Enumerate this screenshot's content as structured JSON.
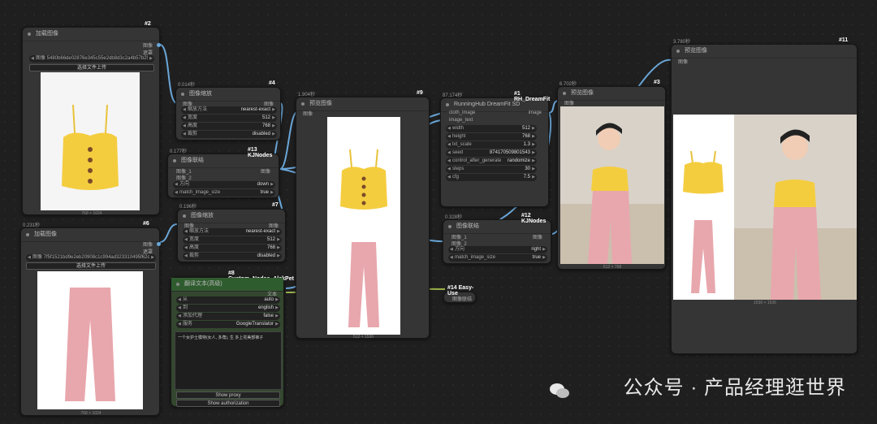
{
  "colors": {
    "wire": "#6aa7d9",
    "node": "#353535",
    "green": "#2f5c2f"
  },
  "load1": {
    "badge": "#2",
    "title": "加载图像",
    "out_image": "图像",
    "out_mask": "遮罩",
    "file": "图像 5480b66de02876e345c55e2db8d3c2a4b57b293...",
    "upload": "选择文件上传",
    "cap": "768 × 1024"
  },
  "load2": {
    "badge": "#6",
    "time": "0.231秒",
    "title": "加载图像",
    "out_image": "图像",
    "out_mask": "遮罩",
    "file": "图像 7f5f1521bd9e2eb20908c1c994ad323310495f62cac...",
    "upload": "选择文件上传",
    "cap": "768 × 1024"
  },
  "scale1": {
    "badge": "#4",
    "time": "0.014秒",
    "title": "图像缩放",
    "in": "图像",
    "out": "图像",
    "rows": [
      [
        "缩放方法",
        "nearest-exact"
      ],
      [
        "宽度",
        "512"
      ],
      [
        "高度",
        "768"
      ],
      [
        "裁剪",
        "disabled"
      ]
    ]
  },
  "scale2": {
    "badge": "#7",
    "time": "0.196秒",
    "title": "图像缩放",
    "in": "图像",
    "out": "图像",
    "rows": [
      [
        "缩放方法",
        "nearest-exact"
      ],
      [
        "宽度",
        "512"
      ],
      [
        "高度",
        "768"
      ],
      [
        "裁剪",
        "disabled"
      ]
    ]
  },
  "concat1": {
    "badge": "#13 KJNodes",
    "time": "0.177秒",
    "title": "图像联结",
    "in1": "图像_1",
    "in2": "图像_2",
    "out": "图像",
    "rows": [
      [
        "方向",
        "down"
      ]
    ],
    "match_label": "match_image_size",
    "match_value": "true"
  },
  "translate": {
    "badge": "#8 Custom_Nodes_AlekPet",
    "title": "翻译文本(高级)",
    "out": "文本",
    "rows": [
      [
        "从",
        "auto"
      ],
      [
        "到",
        "english"
      ],
      [
        "添加代理",
        "false"
      ],
      [
        "服务",
        "GoogleTranslator"
      ]
    ],
    "text": "一个女护士模特(女人, 多角), 生 多上花美部裤子",
    "btn1": "Show proxy",
    "btn2": "Show authorization"
  },
  "preview1": {
    "badge": "#9",
    "time": "1.904秒",
    "title": "预览图像",
    "in": "图像",
    "cap": "512 × 1536"
  },
  "dream": {
    "badge": "#1 RH_DreamFit",
    "time": "87.174秒",
    "title": "RunningHub DreamFit SD",
    "in1": "cloth_image",
    "in2": "image_text",
    "out": "image",
    "rows": [
      [
        "width",
        "512"
      ],
      [
        "height",
        "768"
      ],
      [
        "txt_scale",
        "1.3"
      ],
      [
        "seed",
        "874170509801543"
      ],
      [
        "control_after_generate",
        "randomize"
      ],
      [
        "steps",
        "30"
      ],
      [
        "cfg",
        "7.5"
      ]
    ]
  },
  "concat2": {
    "badge": "#12 KJNodes",
    "time": "0.328秒",
    "title": "图像联结",
    "in1": "图像_1",
    "in2": "图像_2",
    "out": "图像",
    "rows": [
      [
        "方向",
        "right"
      ]
    ],
    "match_label": "match_image_size",
    "match_value": "true"
  },
  "easy": {
    "badge": "#14 Easy-Use",
    "title": "图像联结"
  },
  "preview3": {
    "badge": "#3",
    "time": "6.702秒",
    "title": "预览图像",
    "in": "图像",
    "cap": "512 × 768"
  },
  "preview11": {
    "badge": "#11",
    "time": "3.780秒",
    "title": "预览图像",
    "in": "图像",
    "cap": "1536 × 1536"
  },
  "watermark": "公众号 · 产品经理逛世界"
}
